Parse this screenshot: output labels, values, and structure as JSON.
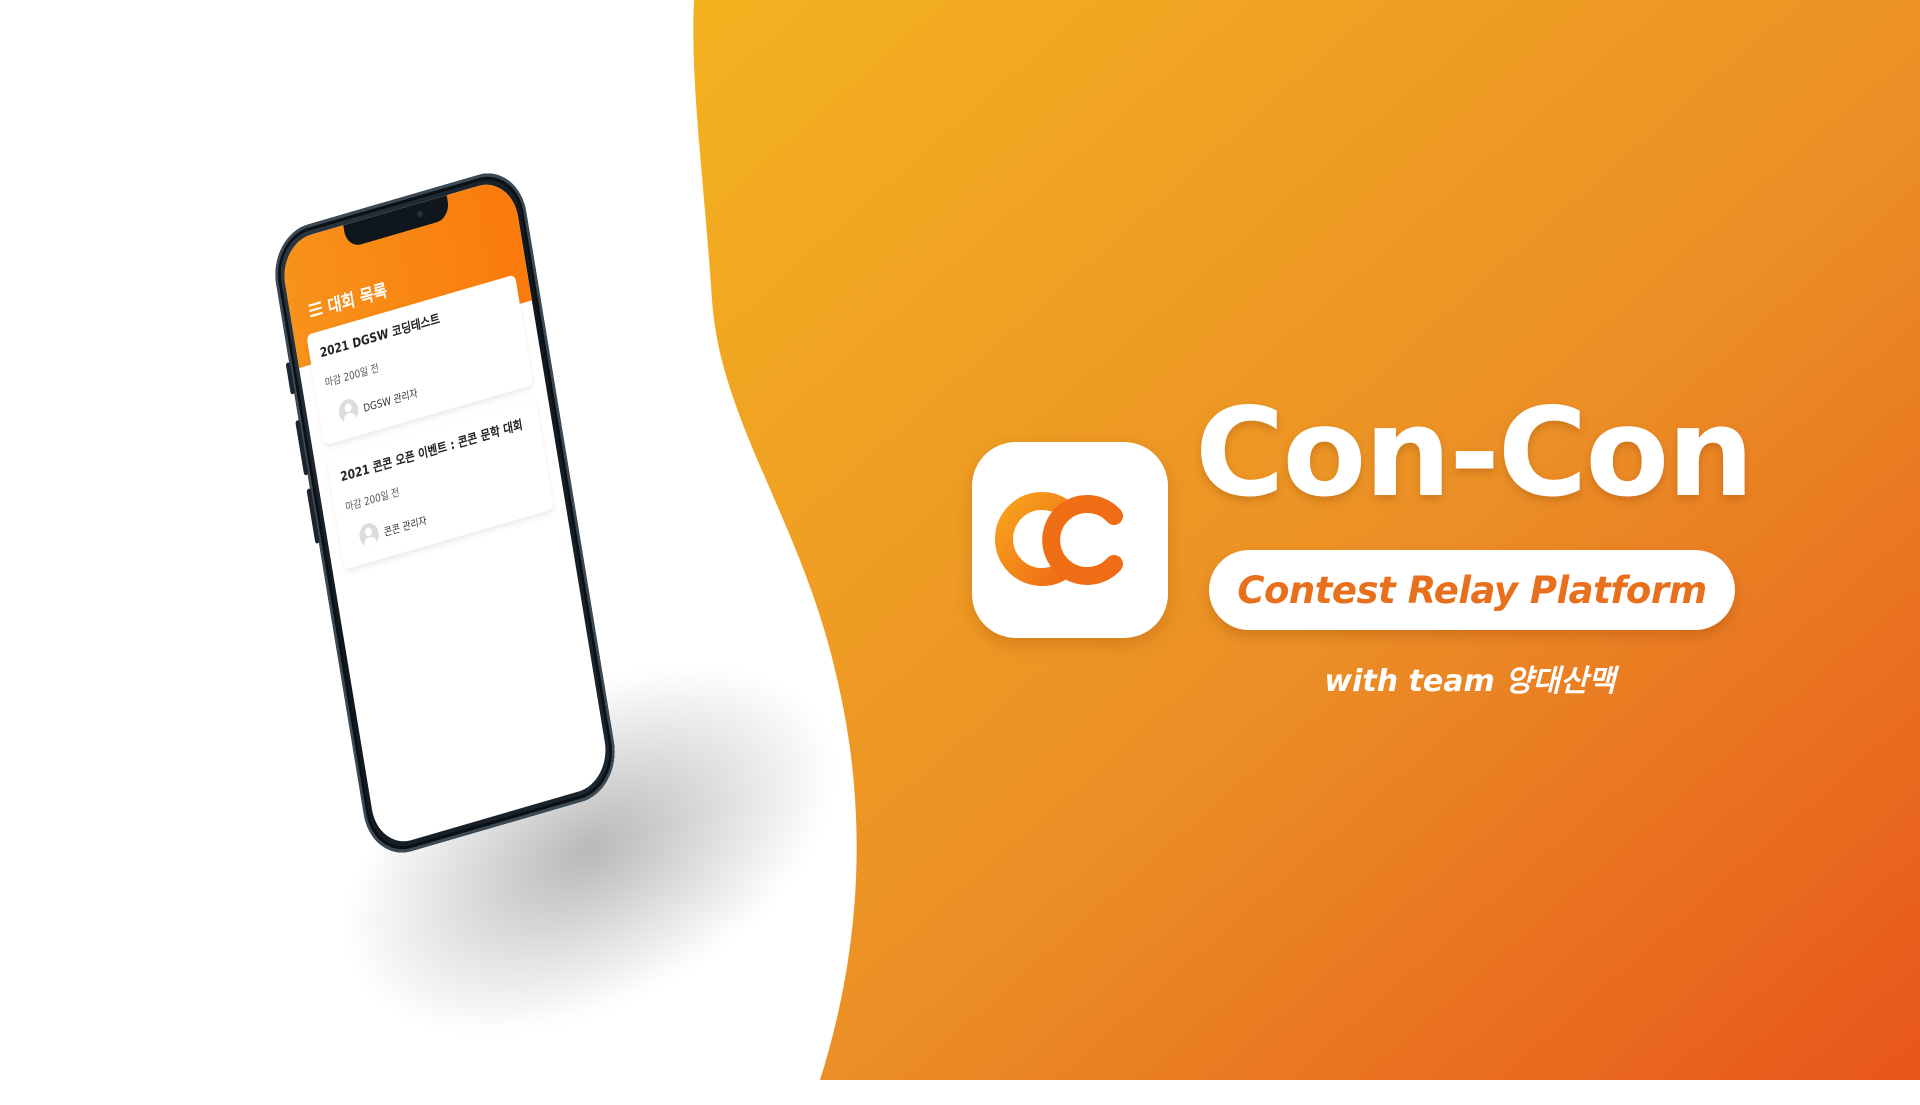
{
  "colors": {
    "gradient_start": "#f4b21f",
    "gradient_end": "#e8561a",
    "brand_orange": "#f27d14",
    "white": "#ffffff"
  },
  "phone_app": {
    "header_icon": "list-icon",
    "header_title": "대회 목록",
    "contests": [
      {
        "title": "2021 DGSW 코딩테스트",
        "deadline": "마감 200일 전",
        "author": "DGSW 관리자"
      },
      {
        "title": "2021 콘콘 오픈 이벤트 : 콘콘 문학 대회",
        "deadline": "마감 200일 전",
        "author": "콘콘 관리자"
      }
    ]
  },
  "brand": {
    "logo_icon": "concon-cc-logo",
    "title": "Con-Con",
    "tagline": "Contest Relay Platform",
    "team_line": "with team 양대산맥"
  }
}
